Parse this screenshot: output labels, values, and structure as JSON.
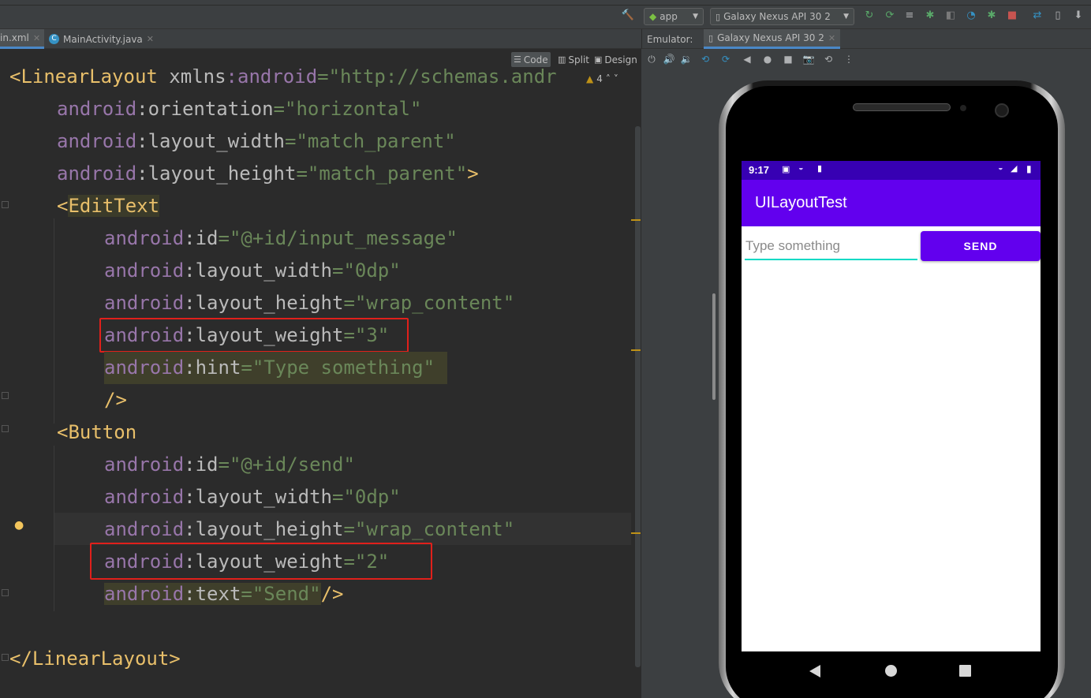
{
  "toolbar": {
    "run_config": "app",
    "device": "Galaxy Nexus API 30 2",
    "icons": [
      "hammer-icon",
      "android-icon",
      "rerun-icon",
      "apply-changes-icon",
      "logcat-icon",
      "debug-icon",
      "attach-debugger-icon",
      "profiler-icon",
      "bug-icon",
      "stop-icon",
      "sync-icon",
      "device-manager-icon",
      "sdk-manager-icon"
    ]
  },
  "tabs": [
    {
      "label": "in.xml",
      "active": true
    },
    {
      "label": "MainActivity.java",
      "active": false
    }
  ],
  "emulator_tab": {
    "prefix": "Emulator:",
    "device": "Galaxy Nexus API 30 2"
  },
  "editor_modes": {
    "code": "Code",
    "split": "Split",
    "design": "Design"
  },
  "inspection": {
    "warning_count": "4"
  },
  "code": {
    "l1_open": "<LinearLayout ",
    "l1_xmlns": "xmlns",
    "l1_colon": ":",
    "l1_android": "android",
    "l1_eq": "=",
    "l1_val": "\"http://schemas.andr",
    "l2_ns": "android",
    "l2_attr": ":orientation",
    "l2_val": "\"horizontal\"",
    "l3_ns": "android",
    "l3_attr": ":layout_width",
    "l3_val": "\"match_parent\"",
    "l4_ns": "android",
    "l4_attr": ":layout_height",
    "l4_val": "\"match_parent\"",
    "l4_close": ">",
    "l5_lt": "<",
    "l5_tag": "EditText",
    "l6_ns": "android",
    "l6_attr": ":id",
    "l6_val": "\"@+id/input_message\"",
    "l7_ns": "android",
    "l7_attr": ":layout_width",
    "l7_val": "\"0dp\"",
    "l8_ns": "android",
    "l8_attr": ":layout_height",
    "l8_val": "\"wrap_content\"",
    "l9_ns": "android",
    "l9_attr": ":layout_weight",
    "l9_val": "\"3\"",
    "l10_ns": "android",
    "l10_attr": ":hint",
    "l10_val": "\"Type something\"",
    "l11": "/>",
    "l12_lt": "<",
    "l12_tag": "Button",
    "l13_ns": "android",
    "l13_attr": ":id",
    "l13_val": "\"@+id/send\"",
    "l14_ns": "android",
    "l14_attr": ":layout_width",
    "l14_val": "\"0dp\"",
    "l15_ns": "android",
    "l15_attr": ":layout_height",
    "l15_val": "\"wrap_content\"",
    "l16_ns": "android",
    "l16_attr": ":layout_weight",
    "l16_val": "\"2\"",
    "l17_ns": "android",
    "l17_attr": ":text",
    "l17_val": "\"Send\"",
    "l17_close": "/>",
    "l19": "</LinearLayout>",
    "eq": "="
  },
  "device_screen": {
    "time": "9:17",
    "app_title": "UILayoutTest",
    "input_hint": "Type something",
    "button_label": "SEND"
  },
  "colors": {
    "primary": "#6200ee",
    "primary_dark": "#3700b3",
    "accent": "#03dac5",
    "highlight_box": "#e0201b"
  }
}
